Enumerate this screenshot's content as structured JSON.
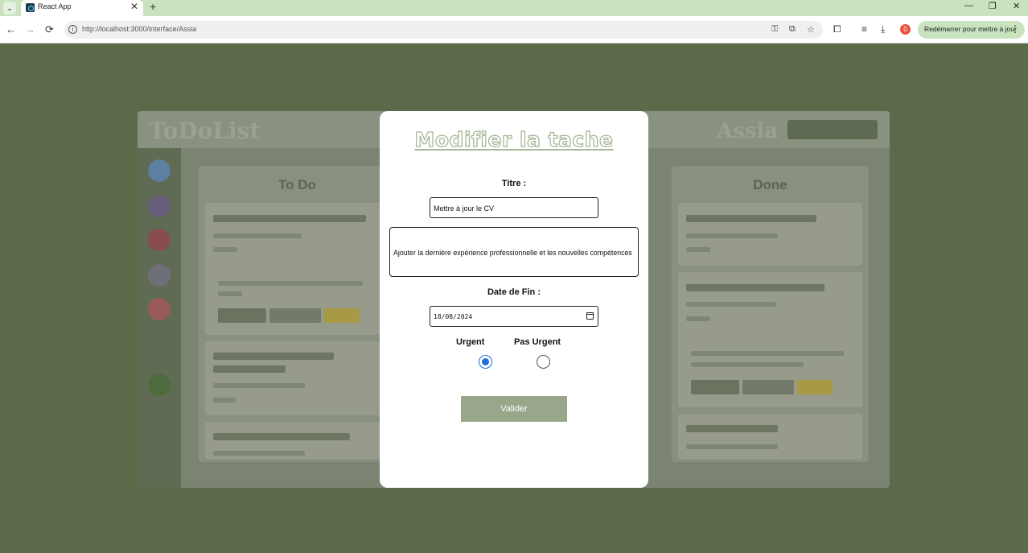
{
  "browser": {
    "tab_menu_glyph": "⌄",
    "tab_title": "React App",
    "tab_close": "✕",
    "new_tab": "+",
    "window_controls": [
      "—",
      "❐",
      "✕"
    ],
    "nav": {
      "back": "←",
      "forward": "→",
      "reload": "⟳"
    },
    "url": "http://localhost:3000/interface/Assia",
    "profile_badge": "0",
    "update_button": "Redémarrer pour mettre à jour",
    "menu_glyph": "⋮"
  },
  "background_app": {
    "logo": "ToDoList",
    "user": "Assia",
    "columns": [
      {
        "title": "To Do"
      },
      {
        "title": "Done"
      }
    ]
  },
  "modal": {
    "title": "Modifier la tache",
    "title_label": "Titre :",
    "title_value": "Mettre à jour le CV",
    "description_value": "Ajouter la dernière expérience professionnelle et les nouvelles compétences",
    "date_label": "Date de Fin :",
    "date_value": "18/08/2024",
    "priority": {
      "urgent_label": "Urgent",
      "not_urgent_label": "Pas Urgent",
      "selected": "Urgent"
    },
    "submit_label": "Valider",
    "accent_color": "#98a68a"
  }
}
